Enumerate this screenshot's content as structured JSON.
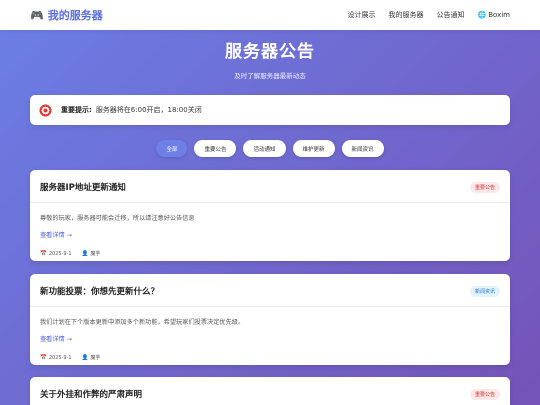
{
  "navbar": {
    "brand_icon": "gamepad-icon",
    "brand": "我的服务器",
    "links": [
      "设计展示",
      "我的服务器",
      "公告通知"
    ],
    "lang_icon": "globe-icon",
    "lang": "Boxim"
  },
  "hero": {
    "title": "服务器公告",
    "subtitle": "及时了解服务器最新动态"
  },
  "notice": {
    "icon": "target-icon",
    "label": "重要提示:",
    "text": "服务器将在6:00开启，18:00关闭"
  },
  "filters": [
    "全部",
    "重要公告",
    "活动通知",
    "维护更新",
    "新闻资讯"
  ],
  "cards": [
    {
      "title": "服务器IP地址更新通知",
      "badge": "重要公告",
      "text": "尊敬的玩家，服务器可能会迁移，所以请注意好公告信息",
      "read_more": "查看详情 →",
      "date": "2025-9-1",
      "author": "魔芋"
    },
    {
      "title": "新功能投票：你想先更新什么？",
      "badge": "新闻资讯",
      "text": "我们计划在下个版本更新中添加多个新功能，希望玩家们投票决定优先级。",
      "read_more": "查看详情 →",
      "date": "2025-9-1",
      "author": "魔芋"
    },
    {
      "title": "关于外挂和作弊的严肃声明",
      "badge": "重要公告"
    }
  ],
  "colors": {
    "accent": "#5a6fe0",
    "important": "#d32f2f",
    "news": "#1976d2"
  }
}
